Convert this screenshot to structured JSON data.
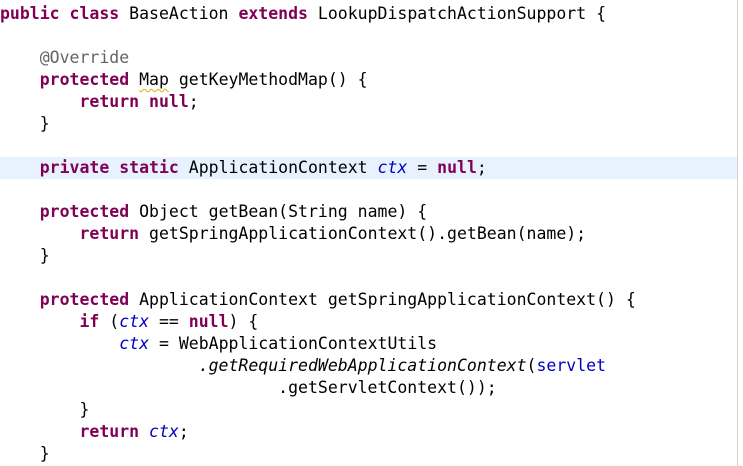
{
  "colors": {
    "keyword": "#7f0055",
    "annotation": "#646464",
    "field": "#0000c0",
    "current_line": "#e8f2fe",
    "warning_underline": "#e0b000",
    "text": "#000000",
    "background": "#ffffff"
  },
  "code": {
    "l1": {
      "kw1": "public",
      "kw2": "class",
      "name": "BaseAction",
      "kw3": "extends",
      "parent": "LookupDispatchActionSupport",
      "brace": "{"
    },
    "l3": {
      "annotation": "@Override"
    },
    "l4": {
      "kw": "protected",
      "type": "Map",
      "rest": "getKeyMethodMap() {"
    },
    "l5": {
      "kw1": "return",
      "kw2": "null",
      "semi": ";"
    },
    "l6": {
      "brace": "}"
    },
    "l8": {
      "kw1": "private",
      "kw2": "static",
      "type": "ApplicationContext",
      "field": "ctx",
      "eq": "=",
      "kw3": "null",
      "semi": ";"
    },
    "l10": {
      "kw": "protected",
      "rest": "Object getBean(String name) {"
    },
    "l11": {
      "kw": "return",
      "rest": "getSpringApplicationContext().getBean(name);"
    },
    "l12": {
      "brace": "}"
    },
    "l14": {
      "kw": "protected",
      "rest": "ApplicationContext getSpringApplicationContext() {"
    },
    "l15": {
      "kw1": "if",
      "open": "(",
      "field": "ctx",
      "op": "==",
      "kw2": "null",
      "close": ") {"
    },
    "l16": {
      "field": "ctx",
      "rest": "= WebApplicationContextUtils"
    },
    "l17": {
      "method": ".getRequiredWebApplicationContext",
      "open": "(",
      "field": "servlet"
    },
    "l18": {
      "rest": ".getServletContext());"
    },
    "l19": {
      "brace": "}"
    },
    "l20": {
      "kw": "return",
      "field": "ctx",
      "semi": ";"
    },
    "l21": {
      "brace": "}"
    }
  }
}
